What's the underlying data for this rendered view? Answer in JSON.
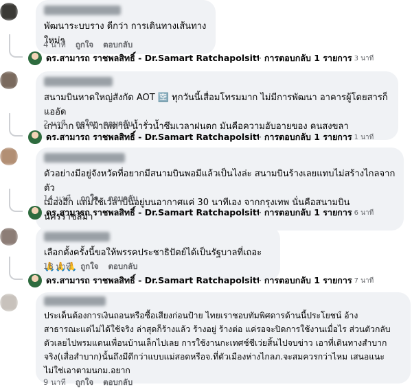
{
  "comments": [
    {
      "text": "พัฒนาระบบราง ดีกว่า การเดินทางเส้นทางใหม่ๆ",
      "time": "4 นาที",
      "like": "ถูกใจ",
      "reply": "ตอบกลับ",
      "reply_summary": {
        "name": "ดร.สามารถ ราชพลสิทธิ์ - Dr.Samart Ratchapolsitte ได้ตอ...",
        "dot": "·",
        "count": "การตอบกลับ 1 รายการ",
        "time": "3 นาที"
      }
    },
    {
      "text": "สนามบินหาดใหญ่สังกัด AOT 🈳 ทุกวันนี้เสื่อมโทรมมาก ไม่มีการพัฒนา อาคารผู้โดยสารก็แออัด\nเก่ามาก เสา ฝ้าเพดาน น้ำรั่วน้ำซึมเวลาฝนตก มันคือความอับอายของ คนสงขลา",
      "time": "2 นาที",
      "like": "ถูกใจ",
      "reply": "ตอบกลับ",
      "reply_summary": {
        "name": "ดร.สามารถ ราชพลสิทธิ์ - Dr.Samart Ratchapolsitte ได้ตอ...",
        "dot": "·",
        "count": "การตอบกลับ 1 รายการ",
        "time": "1 นาที"
      }
    },
    {
      "text": "ตัวอย่างมีอยู่จังหวัดที่อยากมีสนามบินพอมีแล้วเป็นไงล่ะ สนามบินร้างเลยแทบไม่สร้างไกลจากตัว\nเมืองอีก แถมใช้เวลาบินอยู่บนอากาศแค่ 30 นาทีเอง จากกรุงเทพ นั่นคือสนามบินนครราชสีมา",
      "time": "14 นาที",
      "like": "ถูกใจ",
      "reply": "ตอบกลับ",
      "reply_summary": {
        "name": "ดร.สามารถ ราชพลสิทธิ์ - Dr.Samart Ratchapolsitte ได้ตอ...",
        "dot": "·",
        "count": "การตอบกลับ 1 รายการ",
        "time": "6 นาที"
      }
    },
    {
      "text": "เลือกตั้งครั้งนี้ขอให้พรรคประชาธิปัตย์ได้เป็นรัฐบาลที่เถอะ 🙏🙏🙏",
      "time": "18 นาที",
      "like": "ถูกใจ",
      "reply": "ตอบกลับ",
      "reply_summary": {
        "name": "ดร.สามารถ ราชพลสิทธิ์ - Dr.Samart Ratchapolsitte ได้ตอ...",
        "dot": "·",
        "count": "การตอบกลับ 1 รายการ",
        "time": "7 นาที"
      }
    },
    {
      "text": "ประเด็นต้องการเงินถอนหรือซื้อเสียงก่อนป้าย ไทยเราชอบทัมพิศดารด้านนี้ประโยชน์ อ้าง\nสาธารณะแต่ไม่ได้ใช้จริง ล่าสุดก็ร้างแล้ว ร้างอยู่ ร้างต่อ แค่รอจะปิดการใช้งานเมื่อไร ส่วนตัวกลับ\nตัวเลยไปพรมแดนเพื่อนบ้านเล็กไปเลย การใช้งานกะเทศช์ชีเว่ยสิ้นไปจบข่าว เอาที่เดินทางสำบาก\nจริง(เสื่อสำบาก)นั้นถึงมีดีกว่าแบบแม่สอดหรือจ.ที่ตัวเมืองห่างไกลภ.จะสมควรกว่าไหม เสนอแนะ\nไม่ใช่เอาตามนกม.อยาก",
      "time": "9 นาที",
      "like": "ถูกใจ",
      "reply": "ตอบกลับ"
    }
  ],
  "avatar_colors": [
    "#3b3a36",
    "#7a6a5e",
    "#b28f74",
    "#8c7d76",
    "#c8c2bc"
  ],
  "author_bar_color": "#9aa0a6"
}
